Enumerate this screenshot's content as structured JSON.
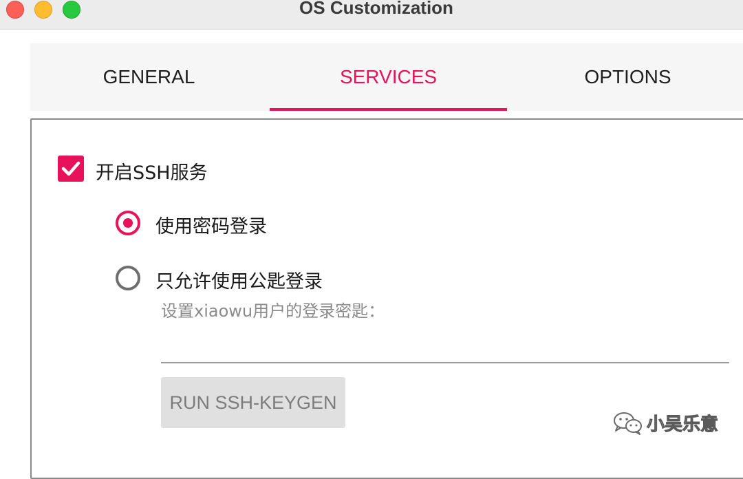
{
  "window": {
    "title": "OS Customization"
  },
  "tabs": [
    {
      "label": "GENERAL",
      "active": false
    },
    {
      "label": "SERVICES",
      "active": true
    },
    {
      "label": "OPTIONS",
      "active": false
    }
  ],
  "services": {
    "ssh_checkbox": {
      "label": "开启SSH服务",
      "checked": true
    },
    "auth_options": [
      {
        "label": "使用密码登录",
        "selected": true
      },
      {
        "label": "只允许使用公匙登录",
        "selected": false
      }
    ],
    "key_hint": "设置xiaowu用户的登录密匙：",
    "key_value": "",
    "keygen_button": "RUN SSH-KEYGEN"
  },
  "watermark": {
    "text": "小吴乐意"
  },
  "colors": {
    "accent": "#e8125a",
    "disabled_button": "#e0e0e0",
    "hint_text": "#8a8a8a"
  },
  "icons": {
    "checkbox": "check-icon",
    "watermark": "wechat-icon"
  }
}
